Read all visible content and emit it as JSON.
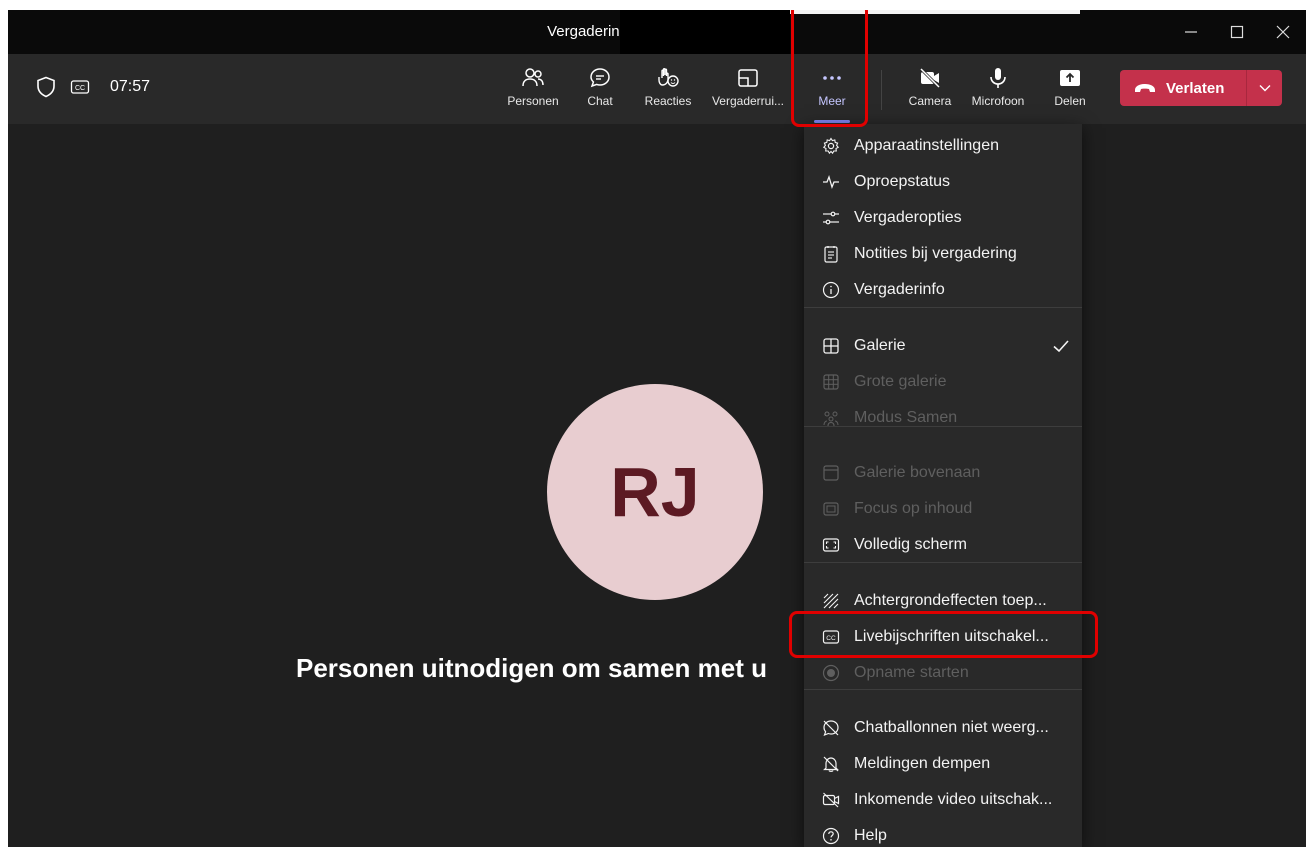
{
  "window": {
    "title": "Vergadering"
  },
  "window_controls": {
    "minimize": "─",
    "maximize": "☐",
    "close": "✕"
  },
  "toolbar": {
    "timer": "07:57",
    "buttons": {
      "personen": "Personen",
      "chat": "Chat",
      "reacties": "Reacties",
      "vergaderruimte": "Vergaderrui...",
      "meer": "Meer",
      "camera": "Camera",
      "microfoon": "Microfoon",
      "delen": "Delen"
    },
    "leave": "Verlaten"
  },
  "stage": {
    "avatar_initials": "RJ",
    "invite_text": "Personen uitnodigen om samen met u"
  },
  "menu": {
    "items": [
      {
        "label": "Apparaatinstellingen",
        "icon": "gear-icon",
        "disabled": false
      },
      {
        "label": "Oproepstatus",
        "icon": "pulse-icon",
        "disabled": false
      },
      {
        "label": "Vergaderopties",
        "icon": "sliders-icon",
        "disabled": false
      },
      {
        "label": "Notities bij vergadering",
        "icon": "notes-icon",
        "disabled": false
      },
      {
        "label": "Vergaderinfo",
        "icon": "info-icon",
        "disabled": false
      },
      {
        "label": "Galerie",
        "icon": "grid-icon",
        "disabled": false,
        "checked": true
      },
      {
        "label": "Grote galerie",
        "icon": "large-grid-icon",
        "disabled": true
      },
      {
        "label": "Modus Samen",
        "icon": "together-icon",
        "disabled": true
      },
      {
        "label": "Galerie bovenaan",
        "icon": "gallery-top-icon",
        "disabled": true
      },
      {
        "label": "Focus op inhoud",
        "icon": "focus-icon",
        "disabled": true
      },
      {
        "label": "Volledig scherm",
        "icon": "fullscreen-icon",
        "disabled": false
      },
      {
        "label": "Achtergrondeffecten toep...",
        "icon": "background-effects-icon",
        "disabled": false
      },
      {
        "label": "Livebijschriften uitschakel...",
        "icon": "cc-icon",
        "disabled": false
      },
      {
        "label": "Opname starten",
        "icon": "record-icon",
        "disabled": true
      },
      {
        "label": "Chatballonnen niet weerg...",
        "icon": "chat-bubble-off-icon",
        "disabled": false
      },
      {
        "label": "Meldingen dempen",
        "icon": "bell-off-icon",
        "disabled": false
      },
      {
        "label": "Inkomende video uitschak...",
        "icon": "video-off-icon",
        "disabled": false
      },
      {
        "label": "Help",
        "icon": "help-icon",
        "disabled": false
      }
    ]
  },
  "colors": {
    "leave_button": "#c4314b",
    "accent": "#7f85f5",
    "highlight": "#e00000"
  }
}
